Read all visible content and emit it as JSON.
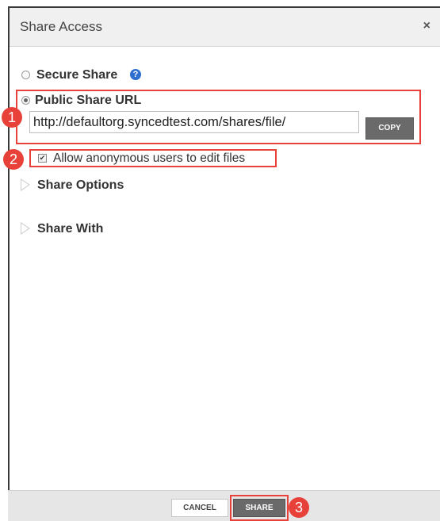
{
  "dialog": {
    "title": "Share Access",
    "close_glyph": "×"
  },
  "secure_share": {
    "label": "Secure Share",
    "help_glyph": "?",
    "selected": false
  },
  "public_share": {
    "label": "Public Share URL",
    "selected": true,
    "url_value": "http://defaultorg.syncedtest.com/shares/file/",
    "copy_label": "COPY"
  },
  "anonymous_edit": {
    "label": "Allow anonymous users to edit files",
    "checked": true,
    "check_glyph": "✔"
  },
  "sections": {
    "share_options": "Share Options",
    "share_with": "Share With"
  },
  "footer": {
    "cancel_label": "CANCEL",
    "share_label": "SHARE"
  },
  "annotations": {
    "marker_1": "1",
    "marker_2": "2",
    "marker_3": "3",
    "color": "#e8413a"
  }
}
